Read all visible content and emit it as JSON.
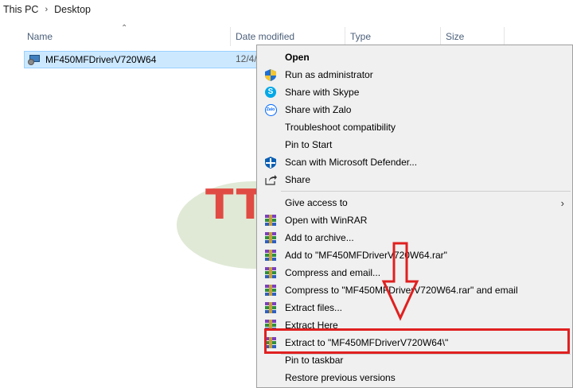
{
  "breadcrumb": {
    "root": "This PC",
    "current": "Desktop"
  },
  "columns": {
    "name": "Name",
    "date_modified": "Date modified",
    "type": "Type",
    "size": "Size"
  },
  "file": {
    "name": "MF450MFDriverV720W64",
    "date": "12/4/"
  },
  "watermark": {
    "text": "TTP"
  },
  "context_menu": {
    "items": [
      {
        "label": "Open",
        "icon": "none"
      },
      {
        "label": "Run as administrator",
        "icon": "uac-shield-icon"
      },
      {
        "label": "Share with Skype",
        "icon": "skype-icon"
      },
      {
        "label": "Share with Zalo",
        "icon": "zalo-icon"
      },
      {
        "label": "Troubleshoot compatibility",
        "icon": "none"
      },
      {
        "label": "Pin to Start",
        "icon": "none"
      },
      {
        "label": "Scan with Microsoft Defender...",
        "icon": "defender-icon"
      },
      {
        "label": "Share",
        "icon": "share-icon"
      },
      {
        "label": "Give access to",
        "icon": "none"
      },
      {
        "label": "Open with WinRAR",
        "icon": "winrar-icon"
      },
      {
        "label": "Add to archive...",
        "icon": "winrar-icon"
      },
      {
        "label": "Add to \"MF450MFDriverV720W64.rar\"",
        "icon": "winrar-icon"
      },
      {
        "label": "Compress and email...",
        "icon": "winrar-icon"
      },
      {
        "label": "Compress to \"MF450MFDriverV720W64.rar\" and email",
        "icon": "winrar-icon"
      },
      {
        "label": "Extract files...",
        "icon": "winrar-icon"
      },
      {
        "label": "Extract Here",
        "icon": "winrar-icon"
      },
      {
        "label": "Extract to \"MF450MFDriverV720W64\\\"",
        "icon": "winrar-icon"
      },
      {
        "label": "Pin to taskbar",
        "icon": "none"
      },
      {
        "label": "Restore previous versions",
        "icon": "none"
      }
    ],
    "zalo_icon_text": "Zalo"
  },
  "colors": {
    "selection": "#cce8ff",
    "highlight": "#e02020",
    "menu_bg": "#f0f0f0"
  }
}
